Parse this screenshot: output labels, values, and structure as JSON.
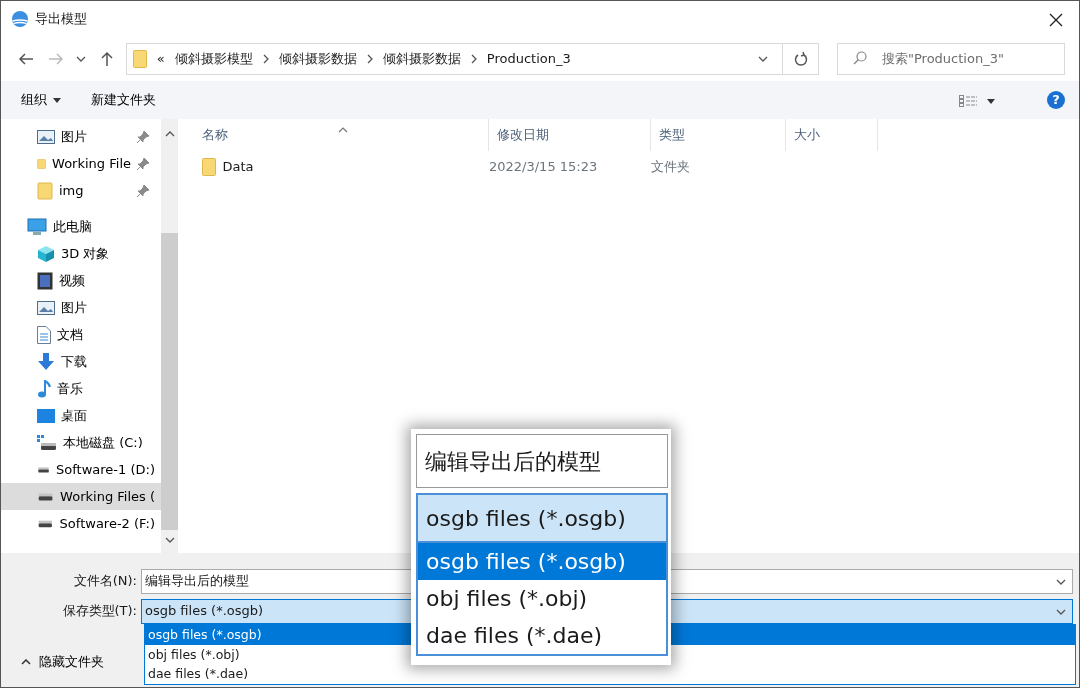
{
  "window": {
    "title": "导出模型"
  },
  "address_bar": {
    "overflow": "«",
    "crumbs": [
      "倾斜摄影模型",
      "倾斜摄影数据",
      "倾斜摄影数据",
      "Production_3"
    ]
  },
  "search": {
    "placeholder": "搜索\"Production_3\""
  },
  "toolbar": {
    "organize": "组织",
    "new_folder": "新建文件夹",
    "help": "?"
  },
  "sidebar": {
    "items": [
      {
        "label": "图片",
        "kind": "picture",
        "pinned": true,
        "selected": false
      },
      {
        "label": "Working File",
        "kind": "folder",
        "pinned": true,
        "selected": false
      },
      {
        "label": "img",
        "kind": "folder",
        "pinned": true,
        "selected": false
      },
      {
        "label": "此电脑",
        "kind": "pc",
        "pinned": false,
        "selected": false,
        "children": [
          {
            "label": "3D 对象",
            "kind": "cube",
            "selected": false
          },
          {
            "label": "视频",
            "kind": "video",
            "selected": false
          },
          {
            "label": "图片",
            "kind": "picture",
            "selected": false
          },
          {
            "label": "文档",
            "kind": "document",
            "selected": false
          },
          {
            "label": "下载",
            "kind": "download",
            "selected": false
          },
          {
            "label": "音乐",
            "kind": "music",
            "selected": false
          },
          {
            "label": "桌面",
            "kind": "desktop",
            "selected": false
          },
          {
            "label": "本地磁盘 (C:)",
            "kind": "system-drive",
            "selected": false
          },
          {
            "label": "Software-1 (D:)",
            "kind": "drive",
            "selected": false
          },
          {
            "label": "Working Files (",
            "kind": "drive",
            "selected": true
          },
          {
            "label": "Software-2 (F:)",
            "kind": "drive",
            "selected": false
          }
        ]
      }
    ]
  },
  "file_list": {
    "columns": [
      {
        "label": "名称",
        "sorted": true
      },
      {
        "label": "修改日期",
        "sorted": false
      },
      {
        "label": "类型",
        "sorted": false
      },
      {
        "label": "大小",
        "sorted": false
      }
    ],
    "rows": [
      {
        "name": "Data",
        "modified": "2022/3/15 15:23",
        "type": "文件夹"
      }
    ]
  },
  "footer": {
    "file_name_label": "文件名(N):",
    "file_name": "编辑导出后的模型",
    "type_label": "保存类型(T):",
    "type_value": "osgb files (*.osgb)",
    "type_options": [
      {
        "label": "osgb files (*.osgb)",
        "selected": true
      },
      {
        "label": "obj files (*.obj)",
        "selected": false
      },
      {
        "label": "dae files (*.dae)",
        "selected": false
      }
    ],
    "hide_folders": "隐藏文件夹"
  },
  "magnifier": {
    "file_name": "编辑导出后的模型",
    "type_value": "osgb files (*.osgb)",
    "type_options": [
      {
        "label": "osgb files (*.osgb)",
        "selected": true
      },
      {
        "label": "obj files (*.obj)",
        "selected": false
      },
      {
        "label": "dae files (*.dae)",
        "selected": false
      }
    ]
  }
}
